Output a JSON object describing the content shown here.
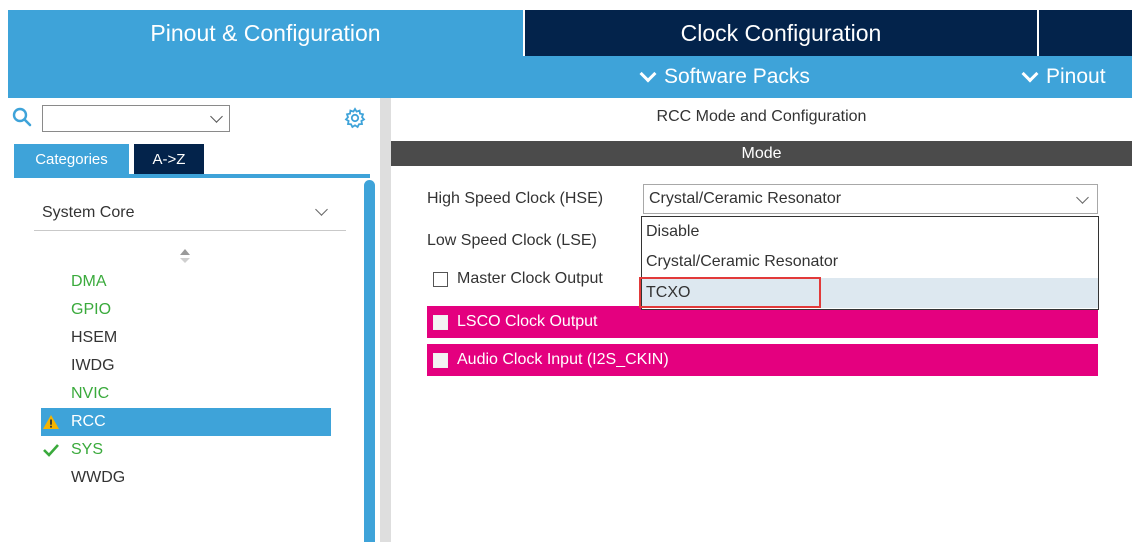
{
  "tabs": {
    "pinout_config": "Pinout & Configuration",
    "clock_config": "Clock Configuration"
  },
  "toolbar": {
    "software_packs": "Software Packs",
    "pinout": "Pinout"
  },
  "left_panel": {
    "search": {
      "value": "",
      "placeholder": ""
    },
    "category_tabs": [
      "Categories",
      "A->Z"
    ],
    "group": "System Core",
    "items": [
      {
        "label": "DMA",
        "status": "ok",
        "color": "#3aaa3c"
      },
      {
        "label": "GPIO",
        "status": "ok",
        "color": "#3aaa3c"
      },
      {
        "label": "HSEM",
        "status": "none",
        "color": "#333333"
      },
      {
        "label": "IWDG",
        "status": "none",
        "color": "#333333"
      },
      {
        "label": "NVIC",
        "status": "ok",
        "color": "#3aaa3c"
      },
      {
        "label": "RCC",
        "status": "warning",
        "selected": true
      },
      {
        "label": "SYS",
        "status": "check",
        "color": "#3aaa3c"
      },
      {
        "label": "WWDG",
        "status": "none",
        "color": "#333333"
      }
    ]
  },
  "right_panel": {
    "title": "RCC Mode and Configuration",
    "section": "Mode",
    "hse": {
      "label": "High Speed Clock (HSE)",
      "value": "Crystal/Ceramic Resonator",
      "options": [
        "Disable",
        "Crystal/Ceramic Resonator",
        "TCXO"
      ],
      "highlighted_option": "TCXO"
    },
    "lse": {
      "label": "Low Speed Clock (LSE)"
    },
    "checkboxes": {
      "master_clock_output": "Master Clock Output",
      "lsco_clock_output": "LSCO Clock Output",
      "audio_clock_input": "Audio Clock Input (I2S_CKIN)"
    }
  },
  "colors": {
    "accent_blue": "#3ea3d9",
    "navy": "#03234b",
    "magenta": "#e4007f",
    "mode_bar": "#4b4b4b",
    "highlight_red": "#e23a3a"
  }
}
